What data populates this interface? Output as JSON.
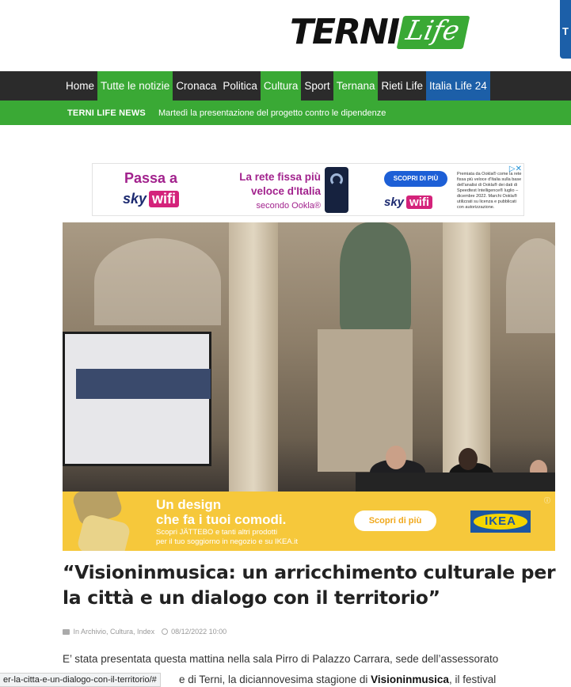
{
  "header": {
    "logo_terni": "TERNI",
    "logo_life": "Life",
    "corner_tab": "T"
  },
  "nav": {
    "items": [
      {
        "label": "Home",
        "style": "plain"
      },
      {
        "label": "Tutte le notizie",
        "style": "green"
      },
      {
        "label": "Cronaca",
        "style": "plain"
      },
      {
        "label": "Politica",
        "style": "plain"
      },
      {
        "label": "Cultura",
        "style": "green"
      },
      {
        "label": "Sport",
        "style": "plain"
      },
      {
        "label": "Ternana",
        "style": "green"
      },
      {
        "label": "Rieti Life",
        "style": "plain"
      },
      {
        "label": "Italia Life 24",
        "style": "blue"
      }
    ]
  },
  "ticker": {
    "label": "TERNI LIFE NEWS",
    "text": "Martedì la presentazione del progetto contro le dipendenze"
  },
  "ad_top": {
    "headline": "Passa a",
    "brand": "sky",
    "brand_wifi": "wifi",
    "claim": "La rete fissa più veloce d'Italia",
    "claim_source": "secondo Ookla®",
    "cta": "SCOPRI DI PIÙ",
    "fine_print": "Premiata da Ookla® come la rete fissa più veloce d'Italia sulla base dell'analisi di Ookla® dei dati di Speedtest Intelligence® luglio – dicembre 2022. Marchi Ookla® utilizzati su licenza e pubblicati con autorizzazione.",
    "close_label": "▷✕"
  },
  "ad_ikea": {
    "headline_1": "Un design",
    "headline_2": "che fa i tuoi comodi.",
    "sub_1": "Scopri JÄTTEBO e tanti altri prodotti",
    "sub_2": "per il tuo soggiorno in negozio e su IKEA.it",
    "cta": "Scopri di più",
    "logo": "IKEA",
    "info_icon": "ⓘ"
  },
  "article": {
    "title": "“Visioninmusica: un arricchimento culturale per la città e un dialogo con il territorio”",
    "categories": "In Archivio, Cultura, Index",
    "date": "08/12/2022 10:00",
    "para_line1": "E’ stata presentata questa mattina nella sala Pirro di Palazzo Carrara, sede dell’assessorato",
    "para_line2_start": "e di Terni, la diciannovesima stagione di ",
    "para_line2_bold": "Visioninmusica",
    "para_line2_end": ", il festival"
  },
  "status_bar": {
    "url": "er-la-citta-e-un-dialogo-con-il-territorio/#"
  },
  "colors": {
    "green": "#3aa935",
    "blue": "#1c5fa8",
    "nav_bg": "#2b2b2b",
    "ikea_yellow": "#f6c83b"
  }
}
